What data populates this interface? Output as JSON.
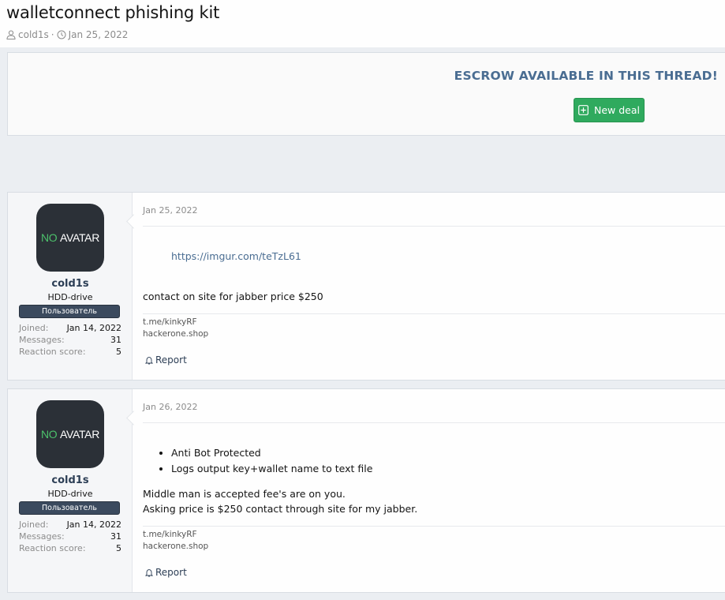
{
  "thread": {
    "title": "walletconnect phishing kit",
    "author": "cold1s",
    "date": "Jan 25, 2022",
    "separator": "·"
  },
  "escrow": {
    "title": "ESCROW AVAILABLE IN THIS THREAD!",
    "button_label": "New deal"
  },
  "posts": [
    {
      "avatar_no": "NO",
      "avatar_rest": "AVATAR",
      "username": "cold1s",
      "user_title": "HDD-drive",
      "banner": "Пользователь",
      "stats": [
        {
          "k": "Joined:",
          "v": "Jan 14, 2022"
        },
        {
          "k": "Messages:",
          "v": "31"
        },
        {
          "k": "Reaction score:",
          "v": "5"
        }
      ],
      "date": "Jan 25, 2022",
      "link": "https://imgur.com/teTzL61",
      "text": "contact on site for jabber price $250",
      "signature": [
        "t.me/kinkyRF",
        "hackerone.shop"
      ],
      "report_label": "Report"
    },
    {
      "avatar_no": "NO",
      "avatar_rest": "AVATAR",
      "username": "cold1s",
      "user_title": "HDD-drive",
      "banner": "Пользователь",
      "stats": [
        {
          "k": "Joined:",
          "v": "Jan 14, 2022"
        },
        {
          "k": "Messages:",
          "v": "31"
        },
        {
          "k": "Reaction score:",
          "v": "5"
        }
      ],
      "date": "Jan 26, 2022",
      "bullets": [
        "Anti Bot Protected",
        "Logs output key+wallet name to text file"
      ],
      "lines": [
        "Middle man is accepted fee's are on you.",
        "Asking price is $250 contact through site for my jabber."
      ],
      "signature": [
        "t.me/kinkyRF",
        "hackerone.shop"
      ],
      "report_label": "Report"
    }
  ],
  "colors": {
    "accent": "#4a6d92",
    "button_green": "#2faa5e",
    "avatar_bg": "#2b3037",
    "avatar_no": "#4cc16b",
    "banner_bg": "#3b4a5e"
  },
  "icons": [
    "user-icon",
    "clock-icon",
    "plus-square-icon",
    "bell-icon"
  ]
}
